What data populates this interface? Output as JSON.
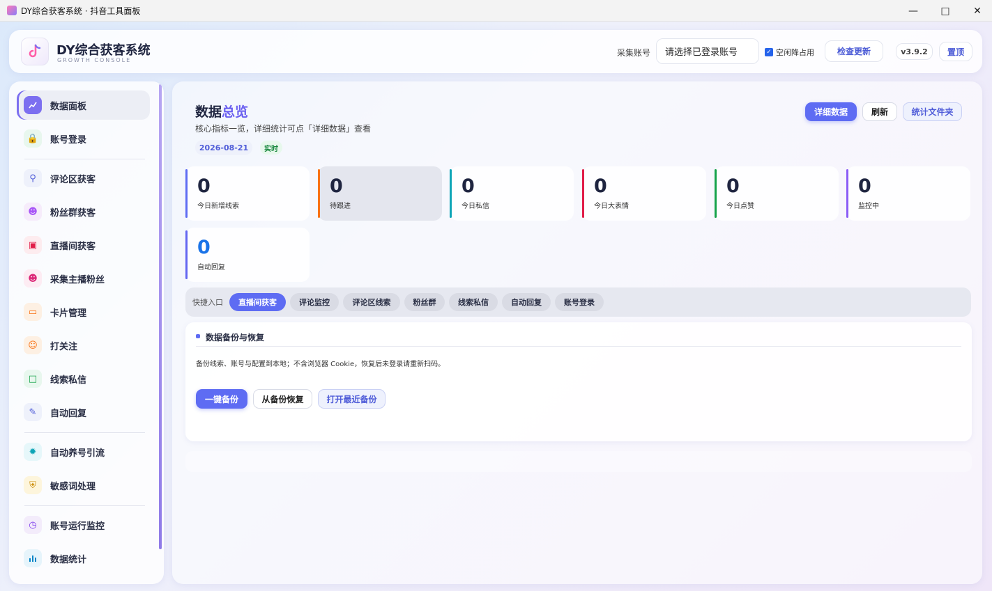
{
  "window": {
    "title": "DY综合获客系统 · 抖音工具面板"
  },
  "header": {
    "brand_title": "DY综合获客系统",
    "brand_subtitle": "GROWTH CONSOLE",
    "account_label": "采集账号",
    "account_select_value": "请选择已登录账号",
    "idle_checkbox_label": "空闲降占用",
    "idle_checked": true,
    "check_update_label": "检查更新",
    "version_label": "v3.9.2",
    "pin_label": "置顶"
  },
  "sidebar": {
    "items": [
      {
        "label": "数据面板",
        "icon": "chart-line-icon",
        "active": true
      },
      {
        "label": "账号登录",
        "icon": "lock-icon"
      },
      {
        "label": "评论区获客",
        "icon": "search-icon"
      },
      {
        "label": "粉丝群获客",
        "icon": "users-icon"
      },
      {
        "label": "直播间获客",
        "icon": "monitor-icon"
      },
      {
        "label": "采集主播粉丝",
        "icon": "users-icon"
      },
      {
        "label": "卡片管理",
        "icon": "card-icon"
      },
      {
        "label": "打关注",
        "icon": "user-plus-icon"
      },
      {
        "label": "线索私信",
        "icon": "message-icon"
      },
      {
        "label": "自动回复",
        "icon": "reply-icon"
      },
      {
        "label": "自动养号引流",
        "icon": "spinner-icon"
      },
      {
        "label": "敏感词处理",
        "icon": "shield-icon"
      },
      {
        "label": "账号运行监控",
        "icon": "clock-icon"
      },
      {
        "label": "数据统计",
        "icon": "bar-chart-icon"
      }
    ]
  },
  "main": {
    "title_prefix": "数据",
    "title_accent": "总览",
    "subtitle": "核心指标一览，详细统计可点「详细数据」查看",
    "date": "2026-08-21",
    "live_badge": "实时",
    "buttons": {
      "detail": "详细数据",
      "refresh": "刷新",
      "stats_folder": "统计文件夹"
    },
    "stats": [
      {
        "value": "0",
        "label": "今日新增线索",
        "color": "#5e6cf3"
      },
      {
        "value": "0",
        "label": "待跟进",
        "color": "#f97316"
      },
      {
        "value": "0",
        "label": "今日私信",
        "color": "#0ea5b7"
      },
      {
        "value": "0",
        "label": "今日大表情",
        "color": "#e11d48"
      },
      {
        "value": "0",
        "label": "今日点赞",
        "color": "#16a34a"
      },
      {
        "value": "0",
        "label": "监控中",
        "color": "#8b5cf6"
      },
      {
        "value": "0",
        "label": "自动回复",
        "color": "#6366f1"
      }
    ],
    "quick": {
      "label": "快捷入口",
      "chips": [
        "直播间获客",
        "评论监控",
        "评论区线索",
        "粉丝群",
        "线索私信",
        "自动回复",
        "账号登录"
      ]
    },
    "backup": {
      "title": "数据备份与恢复",
      "description": "备份线索、账号与配置到本地；不含浏览器 Cookie，恢复后未登录请重新扫码。",
      "buttons": {
        "backup": "一键备份",
        "restore": "从备份恢复",
        "open_latest": "打开最近备份"
      }
    }
  }
}
